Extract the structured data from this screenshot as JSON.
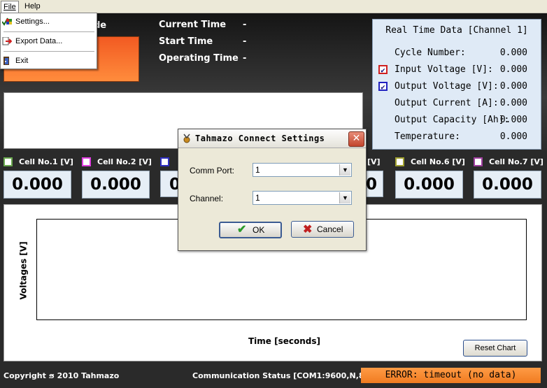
{
  "menubar": {
    "file": "File",
    "help": "Help"
  },
  "file_menu": {
    "settings": "Settings...",
    "export": "Export Data...",
    "exit": "Exit"
  },
  "header": {
    "mode_label_tail": "de",
    "current_time_label": "Current Time",
    "start_time_label": "Start Time",
    "operating_time_label": "Operating Time",
    "current_time_value": "-",
    "start_time_value": "-",
    "operating_time_value": "-"
  },
  "realtime": {
    "title": "Real Time Data [Channel 1]",
    "rows": [
      {
        "label": "Cycle Number:",
        "value": "0.000"
      },
      {
        "label": "Input Voltage [V]:",
        "value": "0.000"
      },
      {
        "label": "Output Voltage [V]:",
        "value": "0.000"
      },
      {
        "label": "Output Current [A]:",
        "value": "0.000"
      },
      {
        "label": "Output Capacity [Ah]:",
        "value": "0.000"
      },
      {
        "label": "Temperature:",
        "value": "0.000"
      }
    ]
  },
  "cells": [
    {
      "label": "Cell No.1 [V]",
      "value": "0.000",
      "color": "#6aa84f"
    },
    {
      "label": "Cell No.2 [V]",
      "value": "0.000",
      "color": "#e040e0"
    },
    {
      "label": "",
      "value": "0",
      "color": "#3030c0"
    },
    {
      "label": "[V]",
      "value": "0",
      "color": "#888888"
    },
    {
      "label": "Cell No.6 [V]",
      "value": "0.000",
      "color": "#a0a030"
    },
    {
      "label": "Cell No.7 [V]",
      "value": "0.000",
      "color": "#a040a0"
    }
  ],
  "chart": {
    "ylabel": "Voltages [V]",
    "xlabel": "Time [seconds]",
    "reset_label": "Reset Chart"
  },
  "status": {
    "copyright": "Copyright ϧ 2010 Tahmazo",
    "communication": "Communication Status [COM1:9600,N,8,1]",
    "error": "ERROR: timeout (no data)"
  },
  "dialog": {
    "title": "Tahmazo Connect Settings",
    "comm_port_label": "Comm Port:",
    "comm_port_value": "1",
    "channel_label": "Channel:",
    "channel_value": "1",
    "ok_label": "OK",
    "cancel_label": "Cancel"
  }
}
